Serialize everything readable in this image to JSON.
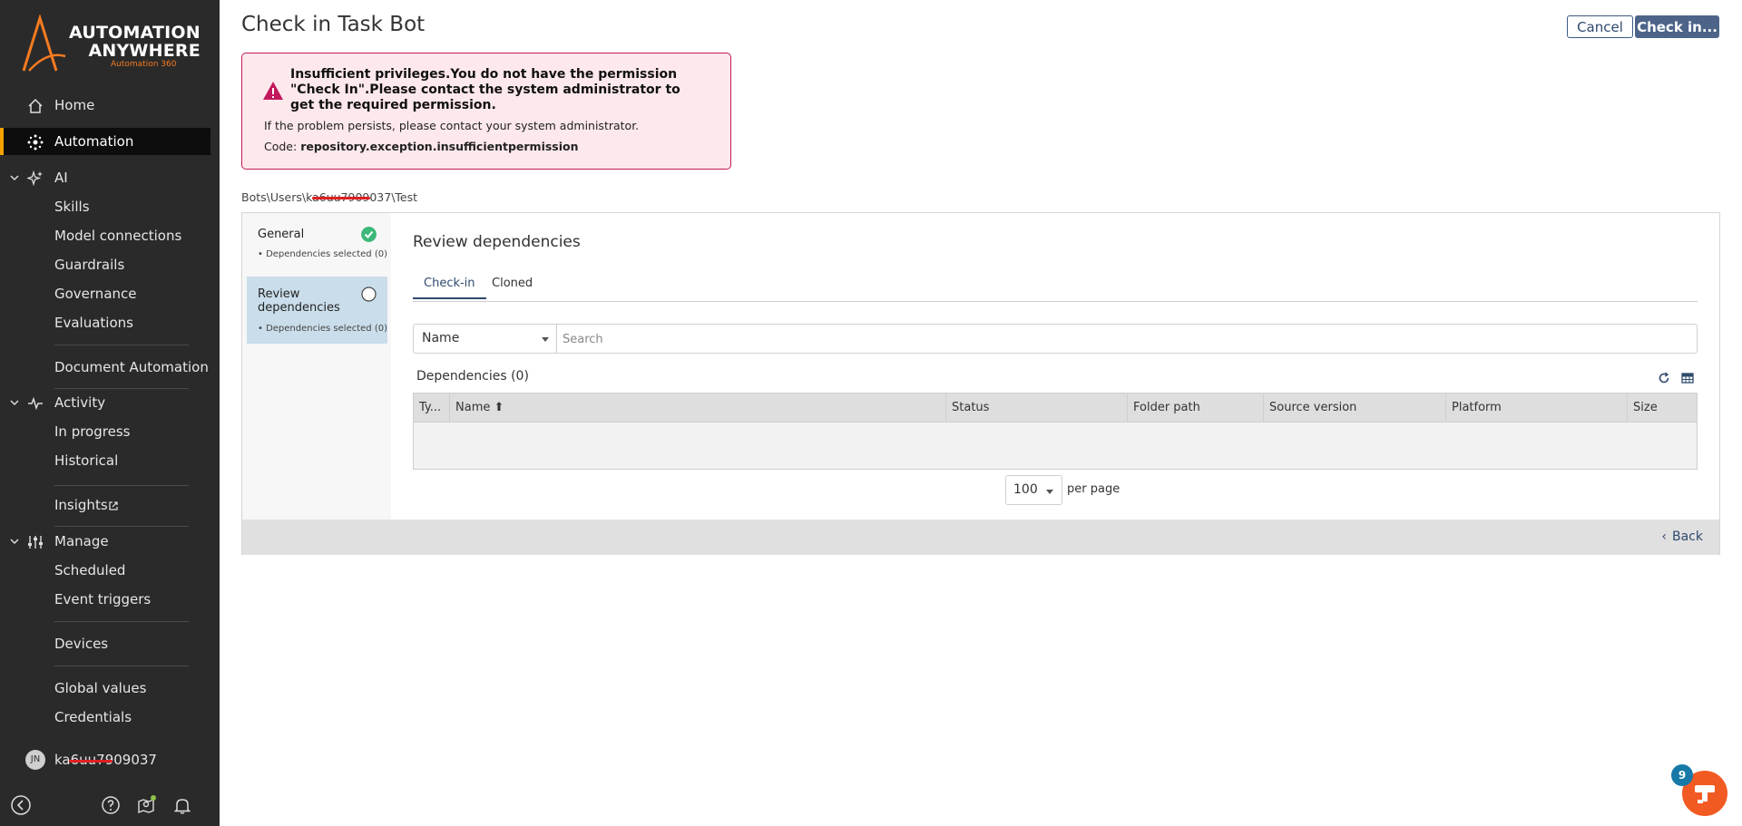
{
  "brand": {
    "line1": "AUTOMATION",
    "line2": "ANYWHERE",
    "sub": "Automation 360"
  },
  "sidebar": {
    "items": [
      {
        "label": "Home",
        "icon": "home-icon"
      },
      {
        "label": "Automation",
        "icon": "automation-icon",
        "active": true
      },
      {
        "label": "AI",
        "icon": "ai-sparkle-icon"
      },
      {
        "label": "Skills"
      },
      {
        "label": "Model connections"
      },
      {
        "label": "Guardrails"
      },
      {
        "label": "Governance"
      },
      {
        "label": "Evaluations"
      },
      {
        "label": "Document Automation"
      },
      {
        "label": "Activity",
        "icon": "activity-pulse-icon"
      },
      {
        "label": "In progress"
      },
      {
        "label": "Historical"
      },
      {
        "label": "Insights",
        "icon": "external-link-icon"
      },
      {
        "label": "Manage",
        "icon": "manage-sliders-icon"
      },
      {
        "label": "Scheduled"
      },
      {
        "label": "Event triggers"
      },
      {
        "label": "Devices"
      },
      {
        "label": "Global values"
      },
      {
        "label": "Credentials"
      }
    ],
    "user": {
      "initials": "JN",
      "name": "ka6uu7909037"
    }
  },
  "header": {
    "title": "Check in Task Bot",
    "cancel_label": "Cancel",
    "checkin_label": "Check in..."
  },
  "error": {
    "title": "Insufficient privileges.You do not have the permission \"Check In\".Please contact the system administrator to get the required permission.",
    "message": "If the problem persists, please contact your system administrator.",
    "code_label": "Code:",
    "code_value": "repository.exception.insufficientpermission"
  },
  "breadcrumb": "Bots\\Users\\ka6uu7909037\\Test",
  "steps": [
    {
      "title": "General",
      "sub": "• Dependencies selected (0)",
      "status": "complete"
    },
    {
      "title": "Review dependencies",
      "sub": "• Dependencies selected (0)",
      "status": "current"
    }
  ],
  "content": {
    "title": "Review dependencies",
    "tabs": [
      "Check-in",
      "Cloned"
    ],
    "active_tab": "Check-in",
    "filter_field": "Name",
    "search_placeholder": "Search",
    "dependencies_title": "Dependencies (0)",
    "columns": [
      "Ty...",
      "Name ⬆",
      "Status",
      "Folder path",
      "Source version",
      "Platform",
      "Size"
    ],
    "rows": [],
    "page_size": "100",
    "per_page_label": "per page",
    "back_label": "Back"
  },
  "bot": {
    "badge": "9"
  },
  "colors": {
    "sidebar_bg": "#2a2a2a",
    "accent_active": "#f5a100",
    "primary_button": "#4d6488",
    "error_border": "#c2185b",
    "error_bg": "#fde8ec",
    "step_complete": "#3cb878",
    "fab": "#f15a22",
    "badge": "#1679a8"
  }
}
